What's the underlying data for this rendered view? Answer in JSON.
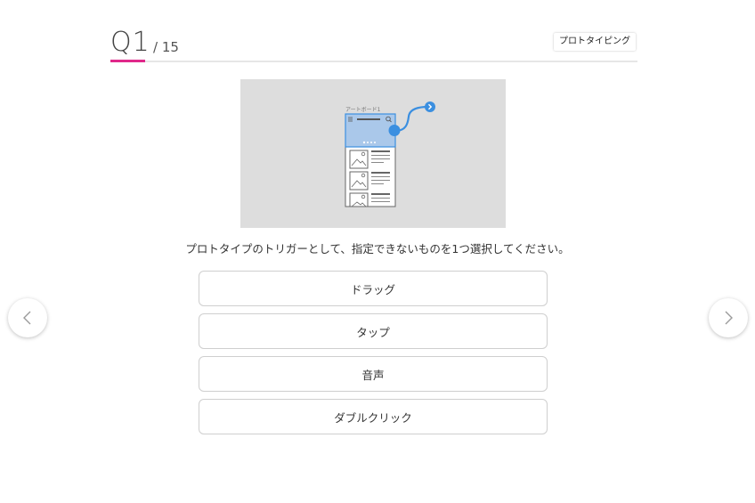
{
  "header": {
    "question_number": "Q1",
    "question_total": "/ 15",
    "category": "プロトタイピング",
    "progress": 0.0667
  },
  "illustration": {
    "artboard_label": "アートボード1"
  },
  "question": {
    "text": "プロトタイプのトリガーとして、指定できないものを1つ選択してください。"
  },
  "options": [
    {
      "label": "ドラッグ"
    },
    {
      "label": "タップ"
    },
    {
      "label": "音声"
    },
    {
      "label": "ダブルクリック"
    }
  ],
  "navigation": {
    "prev_icon": "chevron-left-icon",
    "next_icon": "chevron-right-icon"
  },
  "colors": {
    "accent": "#e0288a",
    "illustration_bg": "#dddddd",
    "link_blue": "#3b8fe0"
  }
}
